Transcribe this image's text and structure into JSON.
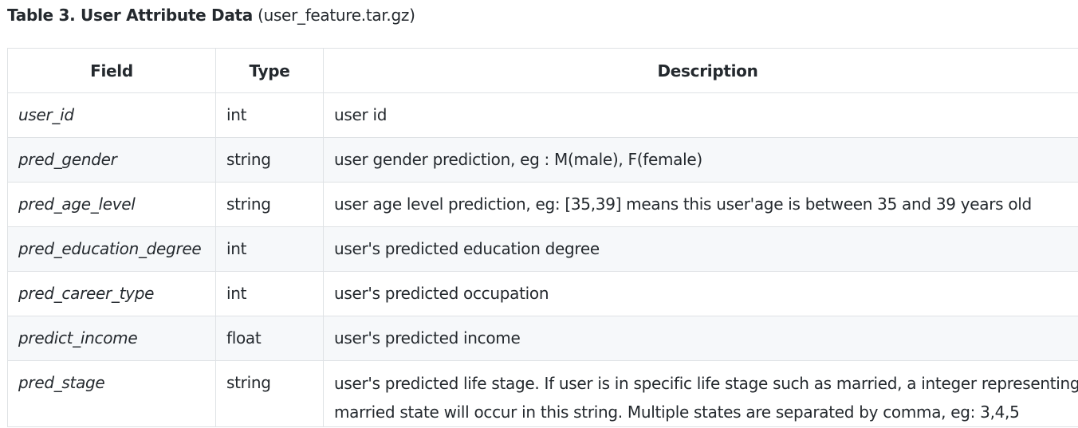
{
  "caption": {
    "title": "Table 3. User Attribute Data",
    "file": "(user_feature.tar.gz)"
  },
  "table": {
    "headers": [
      "Field",
      "Type",
      "Description"
    ],
    "rows": [
      {
        "field": "user_id",
        "type": "int",
        "description": "user id"
      },
      {
        "field": "pred_gender",
        "type": "string",
        "description": "user gender prediction, eg : M(male), F(female)"
      },
      {
        "field": "pred_age_level",
        "type": "string",
        "description": "user age level prediction, eg: [35,39] means this user'age is between 35 and 39 years old"
      },
      {
        "field": "pred_education_degree",
        "type": "int",
        "description": "user's predicted education degree"
      },
      {
        "field": "pred_career_type",
        "type": "int",
        "description": "user's predicted occupation"
      },
      {
        "field": "predict_income",
        "type": "float",
        "description": "user's predicted income"
      },
      {
        "field": "pred_stage",
        "type": "string",
        "description": "user's predicted life stage. If user is in specific life stage such as married, a integer representing married state will occur in this string. Multiple states are separated by comma, eg: 3,4,5"
      }
    ]
  }
}
